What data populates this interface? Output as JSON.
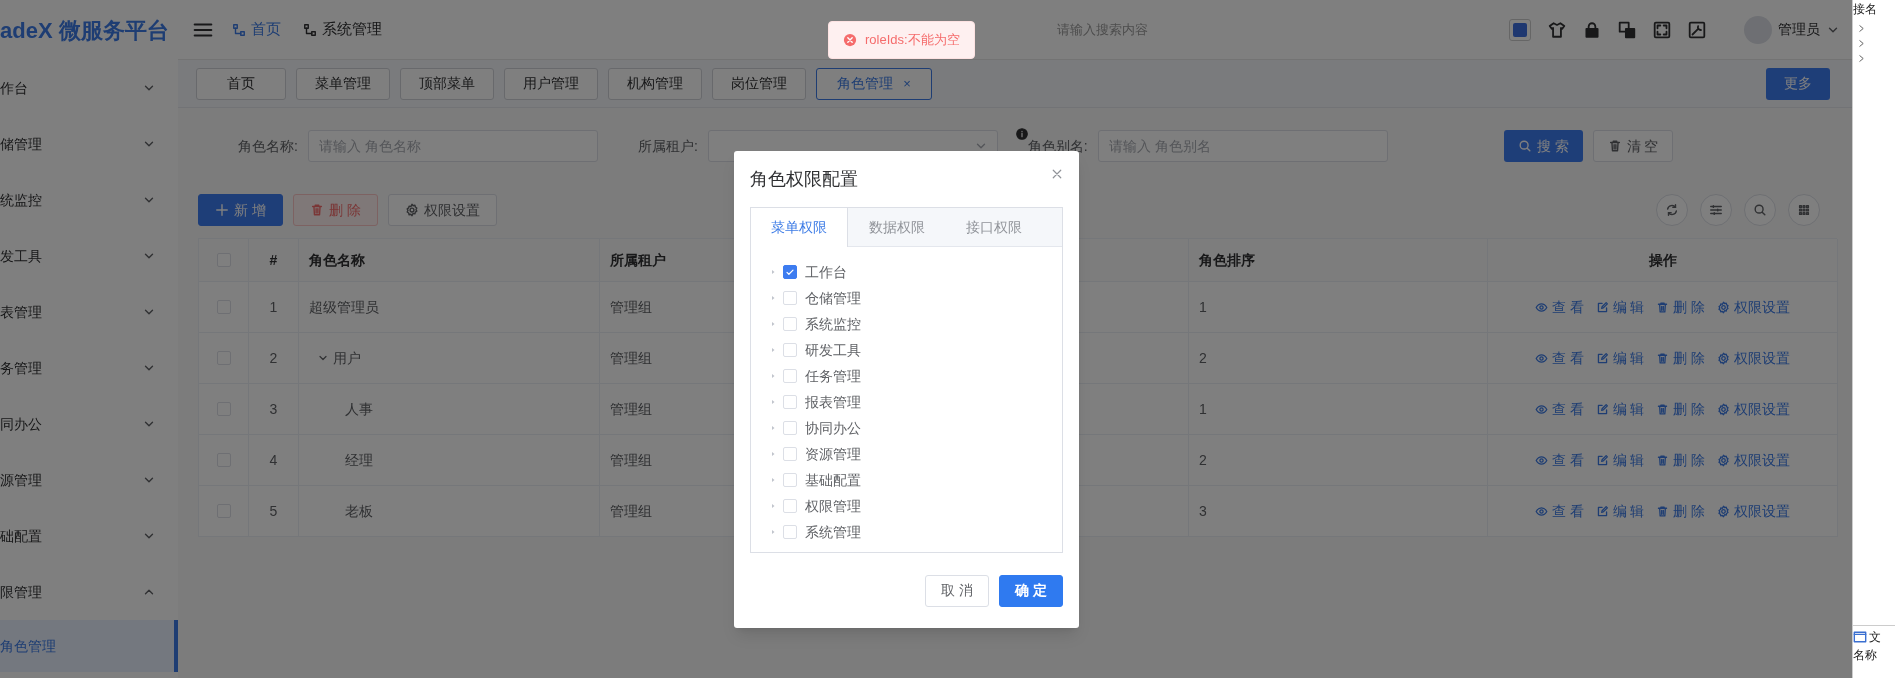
{
  "logo": "adeX 微服务平台",
  "sidebar": {
    "items": [
      {
        "label": "作台",
        "expanded": false
      },
      {
        "label": "储管理",
        "expanded": false
      },
      {
        "label": "统监控",
        "expanded": false
      },
      {
        "label": "发工具",
        "expanded": false
      },
      {
        "label": "表管理",
        "expanded": false
      },
      {
        "label": "务管理",
        "expanded": false
      },
      {
        "label": "同办公",
        "expanded": false
      },
      {
        "label": "源管理",
        "expanded": false
      },
      {
        "label": "础配置",
        "expanded": false
      },
      {
        "label": "限管理",
        "expanded": true,
        "children": [
          {
            "label": "角色管理",
            "selected": true
          }
        ]
      }
    ]
  },
  "header": {
    "breadcrumbs": [
      {
        "label": "首页",
        "selected": true
      },
      {
        "label": "系统管理",
        "selected": false
      }
    ],
    "search": {
      "placeholder": "请输入搜索内容"
    },
    "user": "管理员"
  },
  "tabs": [
    {
      "label": "首页",
      "selected": false
    },
    {
      "label": "菜单管理",
      "selected": false
    },
    {
      "label": "顶部菜单",
      "selected": false
    },
    {
      "label": "用户管理",
      "selected": false
    },
    {
      "label": "机构管理",
      "selected": false
    },
    {
      "label": "岗位管理",
      "selected": false
    },
    {
      "label": "角色管理",
      "selected": true,
      "close": "×"
    }
  ],
  "more_button": "更多",
  "filters": [
    {
      "label": "角色名称:",
      "placeholder": "请输入 角色名称",
      "kind": "input"
    },
    {
      "label": "所属租户:",
      "kind": "select"
    },
    {
      "label": "角色别名:",
      "placeholder": "请输入 角色别名",
      "kind": "input",
      "info": true
    }
  ],
  "search_button": "搜 索",
  "clear_button": "清 空",
  "toolbar": [
    {
      "label": "新 增",
      "kind": "primary"
    },
    {
      "label": "删 除",
      "kind": "danger"
    },
    {
      "label": "权限设置",
      "kind": "plain"
    }
  ],
  "table": {
    "columns": [
      "#",
      "角色名称",
      "所属租户",
      "角色排序",
      "操作"
    ],
    "header_checked": false,
    "rows": [
      {
        "checked": false,
        "index": "1",
        "name": "超级管理员",
        "tenant": "管理组",
        "sort": "1",
        "actions": [
          "查 看",
          "编 辑",
          "删 除",
          "权限设置"
        ]
      },
      {
        "checked": false,
        "index": "2",
        "name": "用户",
        "tenant": "管理组",
        "sort": "2",
        "actions": [
          "查 看",
          "编 辑",
          "删 除",
          "权限设置"
        ],
        "expanded": true,
        "children": [
          {
            "checked": false,
            "index": "3",
            "name": "人事",
            "tenant": "管理组",
            "sort": "1",
            "actions": [
              "查 看",
              "编 辑",
              "删 除",
              "权限设置"
            ]
          },
          {
            "checked": false,
            "index": "4",
            "name": "经理",
            "tenant": "管理组",
            "sort": "2",
            "actions": [
              "查 看",
              "编 辑",
              "删 除",
              "权限设置"
            ]
          },
          {
            "checked": false,
            "index": "5",
            "name": "老板",
            "tenant": "管理组",
            "sort": "3",
            "actions": [
              "查 看",
              "编 辑",
              "删 除",
              "权限设置"
            ]
          }
        ]
      }
    ]
  },
  "toast": {
    "message": "roleIds:不能为空"
  },
  "dialog": {
    "title": "角色权限配置",
    "tabs": [
      {
        "label": "菜单权限",
        "selected": true
      },
      {
        "label": "数据权限",
        "selected": false
      },
      {
        "label": "接口权限",
        "selected": false
      }
    ],
    "tree": [
      {
        "label": "工作台",
        "checked": true
      },
      {
        "label": "仓储管理",
        "checked": false
      },
      {
        "label": "系统监控",
        "checked": false
      },
      {
        "label": "研发工具",
        "checked": false
      },
      {
        "label": "任务管理",
        "checked": false
      },
      {
        "label": "报表管理",
        "checked": false
      },
      {
        "label": "协同办公",
        "checked": false
      },
      {
        "label": "资源管理",
        "checked": false
      },
      {
        "label": "基础配置",
        "checked": false
      },
      {
        "label": "权限管理",
        "checked": false
      },
      {
        "label": "系统管理",
        "checked": false
      }
    ],
    "buttons": [
      {
        "label": "取 消",
        "kind": "cancel"
      },
      {
        "label": "确 定",
        "kind": "confirm"
      }
    ]
  },
  "side_window": {
    "texts": [
      "接名",
      "文",
      "名称"
    ]
  }
}
